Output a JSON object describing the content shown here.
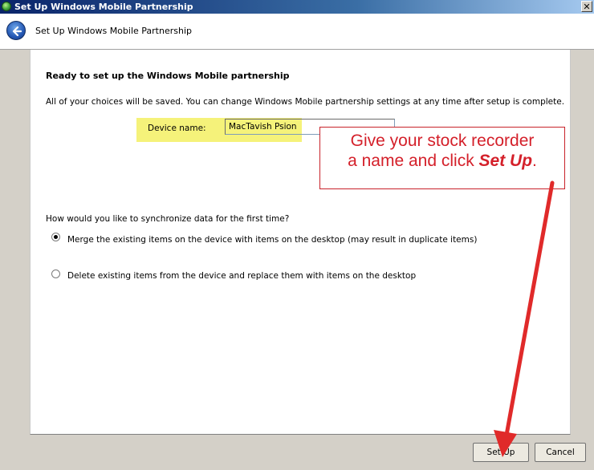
{
  "window": {
    "title": "Set Up Windows Mobile Partnership",
    "close_label": "✕"
  },
  "navbar": {
    "title": "Set Up Windows Mobile Partnership"
  },
  "content": {
    "heading": "Ready to set up the Windows Mobile partnership",
    "info": "All of your choices will be saved. You can change Windows Mobile partnership settings at any time after setup is complete.",
    "device_name_label": "Device name:",
    "device_name_value": "MacTavish Psion",
    "sync_question": "How would you like to synchronize data for the first time?",
    "options": [
      {
        "label": "Merge the existing items on the device with items on the desktop (may result in duplicate items)",
        "selected": true
      },
      {
        "label": "Delete existing items from the device and replace them with items on the desktop",
        "selected": false
      }
    ]
  },
  "annotation": {
    "line1": "Give your stock recorder",
    "line2_prefix": "a name and click ",
    "line2_emphasis": "Set Up",
    "line2_suffix": ".",
    "color": "#d4202a"
  },
  "footer": {
    "setup_label": "Set Up",
    "cancel_label": "Cancel"
  },
  "icons": {
    "app": "windows-mobile-icon",
    "back": "back-arrow-icon",
    "close": "close-icon"
  }
}
